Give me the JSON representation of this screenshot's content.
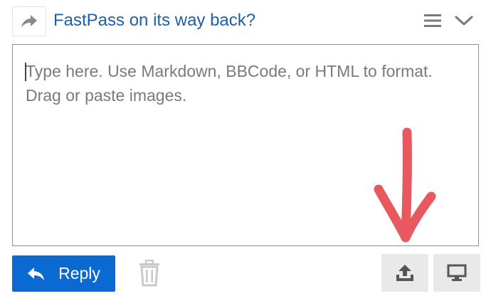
{
  "header": {
    "topic_title": "FastPass on its way back?",
    "icons": {
      "reply_to": "share-forward-icon",
      "menu": "hamburger-menu-icon",
      "collapse": "chevron-down-icon"
    }
  },
  "editor": {
    "placeholder": "Type here. Use Markdown, BBCode, or HTML to format. Drag or paste images.",
    "value": ""
  },
  "footer": {
    "reply_label": "Reply",
    "icons": {
      "reply": "reply-arrow-icon",
      "trash": "trash-icon",
      "upload": "upload-icon",
      "preview": "monitor-icon"
    }
  },
  "annotation": {
    "color": "#e8585f",
    "icon": "down-arrow-annotation"
  },
  "colors": {
    "accent": "#0a6ad1",
    "title": "#1f5fa5",
    "button_gray": "#e9e9e9",
    "icon_gray": "#6b6b6b"
  }
}
